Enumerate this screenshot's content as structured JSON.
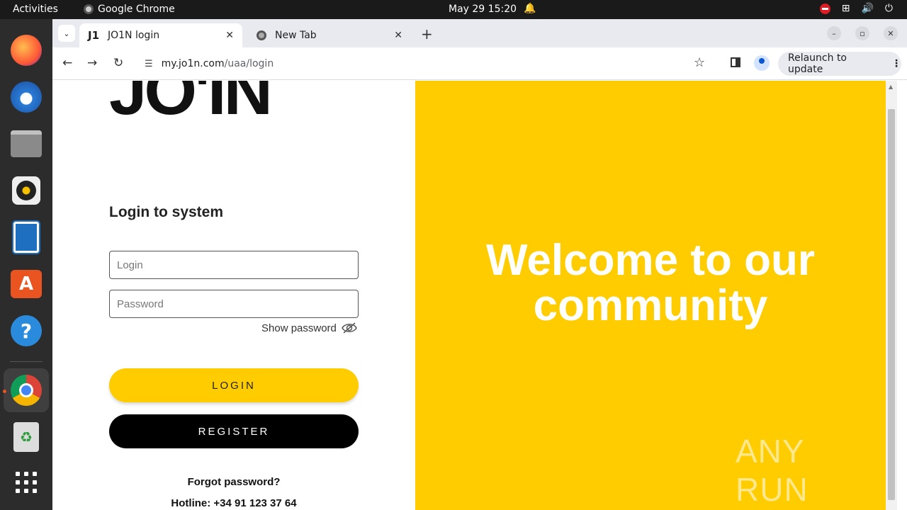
{
  "topbar": {
    "activities": "Activities",
    "app_name": "Google Chrome",
    "datetime": "May 29  15:20"
  },
  "dock": {
    "items": [
      "firefox-icon",
      "thunderbird-icon",
      "files-icon",
      "rhythmbox-icon",
      "libreoffice-writer-icon",
      "app-center-icon",
      "help-icon",
      "chrome-icon",
      "trash-icon",
      "show-apps-icon"
    ]
  },
  "browser": {
    "tabs": [
      {
        "title": "JO1N login",
        "favicon": "J1",
        "active": true
      },
      {
        "title": "New Tab",
        "active": false
      }
    ],
    "url_host": "my.jo1n.com",
    "url_path": "/uaa/login",
    "relaunch_label": "Relaunch to update"
  },
  "login": {
    "logo_text": "JO'IN",
    "heading": "Login to system",
    "login_placeholder": "Login",
    "password_placeholder": "Password",
    "show_password": "Show password",
    "login_button": "LOGIN",
    "register_button": "REGISTER",
    "forgot_password": "Forgot password?",
    "hotline": "Hotline: +34 91 123 37 64"
  },
  "banner": {
    "welcome_line1": "Welcome to our",
    "welcome_line2": "community",
    "background_color": "#ffcc00",
    "watermark": "ANY RUN"
  }
}
